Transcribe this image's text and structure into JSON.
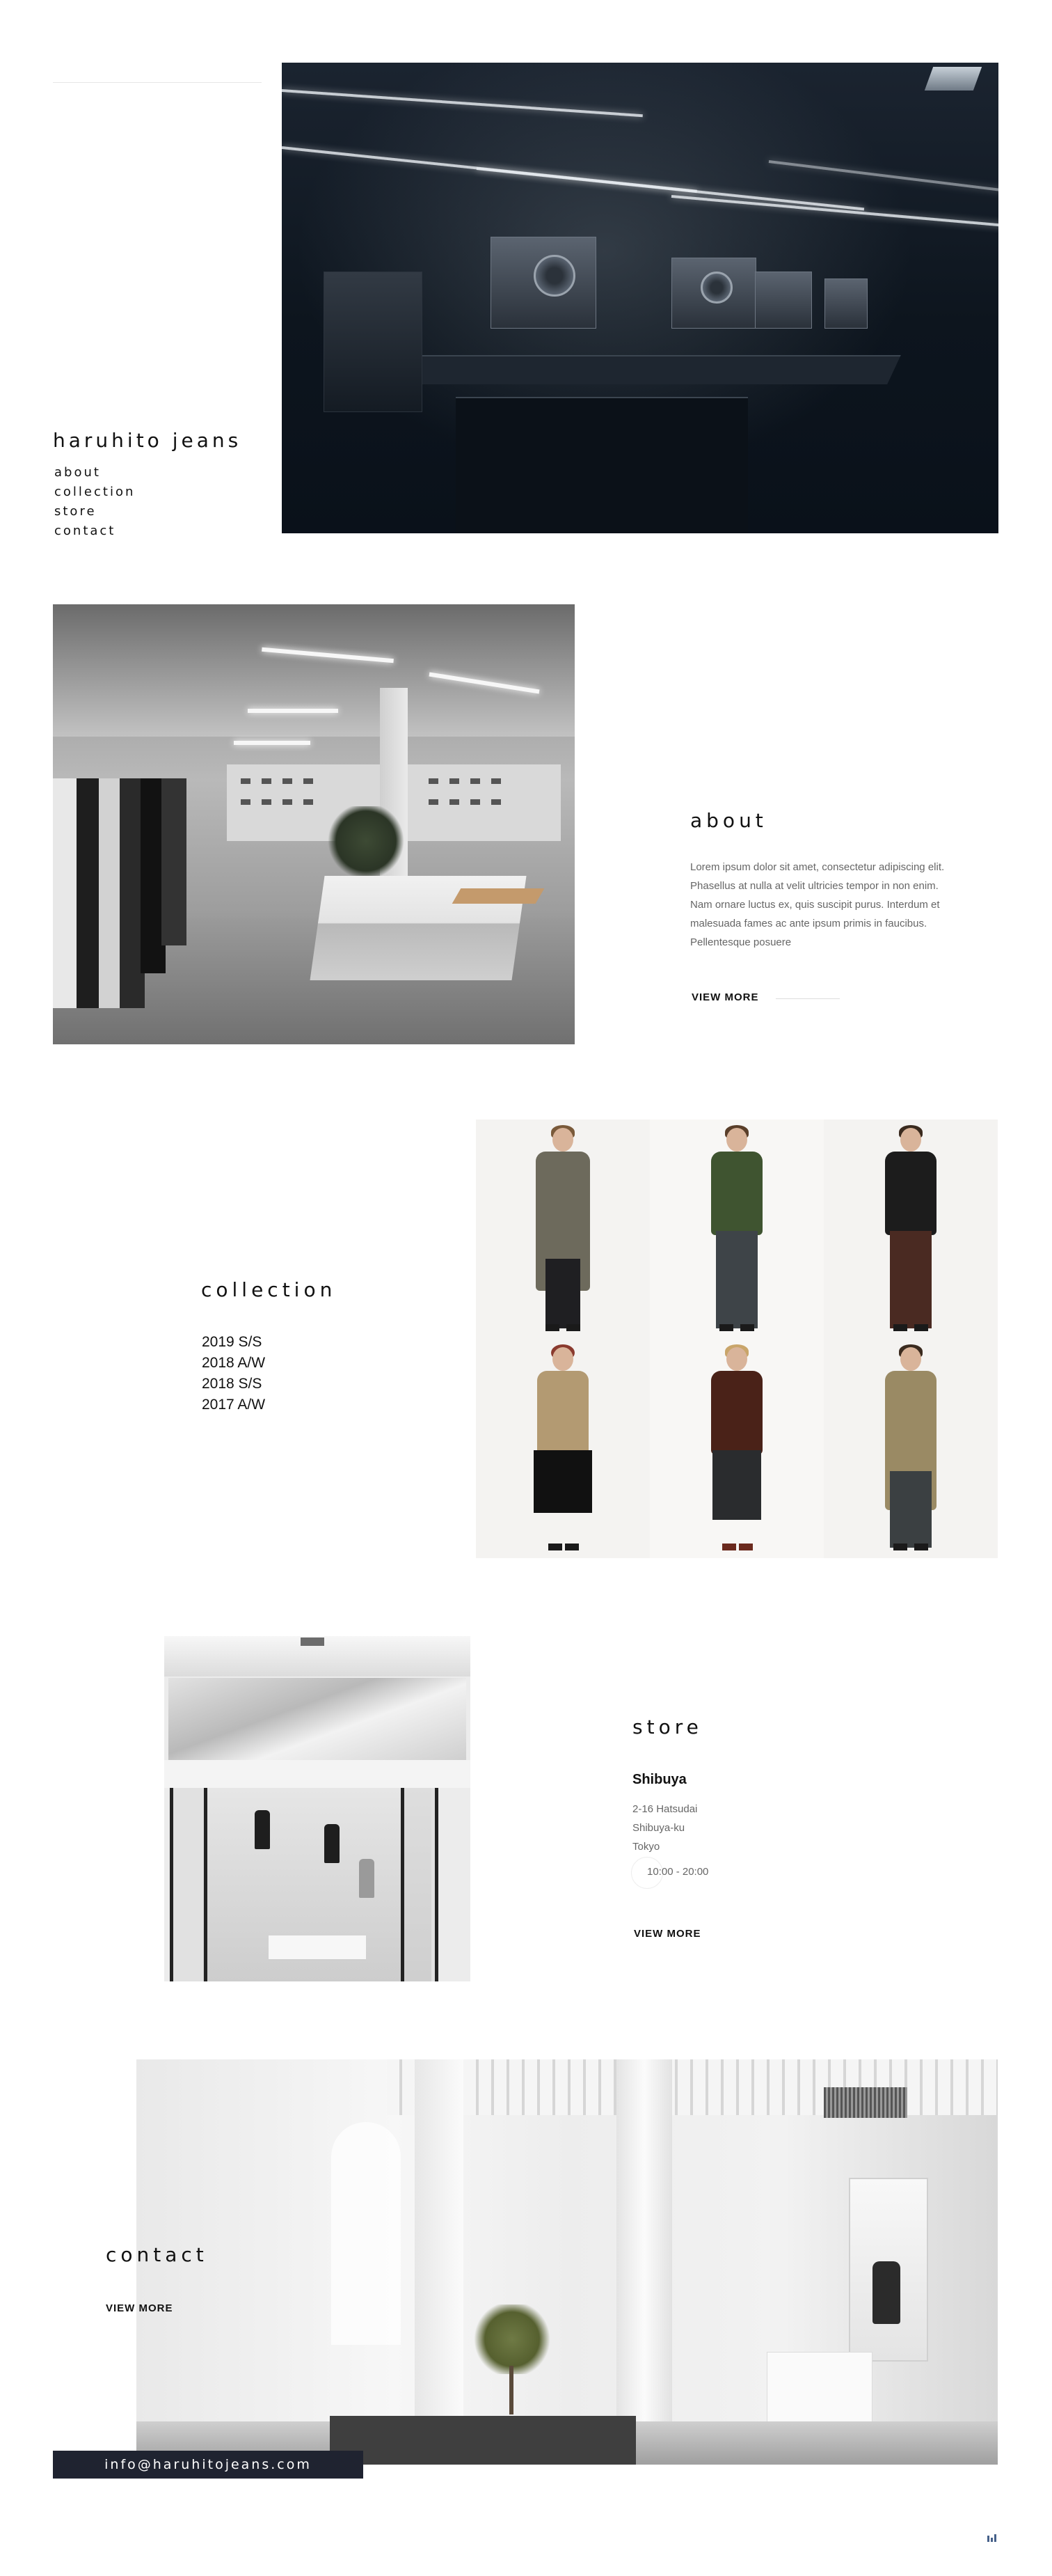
{
  "brand": "haruhito jeans",
  "nav": [
    "about",
    "collection",
    "store",
    "contact"
  ],
  "about": {
    "title": "about",
    "text": "Lorem ipsum dolor sit amet, consectetur adipiscing elit. Phasellus at nulla at velit ultricies tempor in non enim. Nam ornare luctus ex, quis suscipit purus. Interdum et malesuada fames ac ante ipsum primis in faucibus. Pellentesque posuere",
    "view_more": "VIEW MORE"
  },
  "collection": {
    "title": "collection",
    "items": [
      "2019 S/S",
      "2018 A/W",
      "2018 S/S",
      "2017 A/W"
    ]
  },
  "store": {
    "title": "store",
    "name": "Shibuya",
    "address": [
      "2-16 Hatsudai",
      "Shibuya-ku",
      "Tokyo"
    ],
    "hours": "10:00 - 20:00",
    "view_more": "VIEW MORE"
  },
  "contact": {
    "title": "contact",
    "view_more": "VIEW MORE",
    "email": "info@haruhitojeans.com"
  },
  "icons": {
    "corner_mark": "page-mark-icon"
  },
  "colors": {
    "email_bar": "#1f2330",
    "hero_dark": "#0d151e"
  }
}
